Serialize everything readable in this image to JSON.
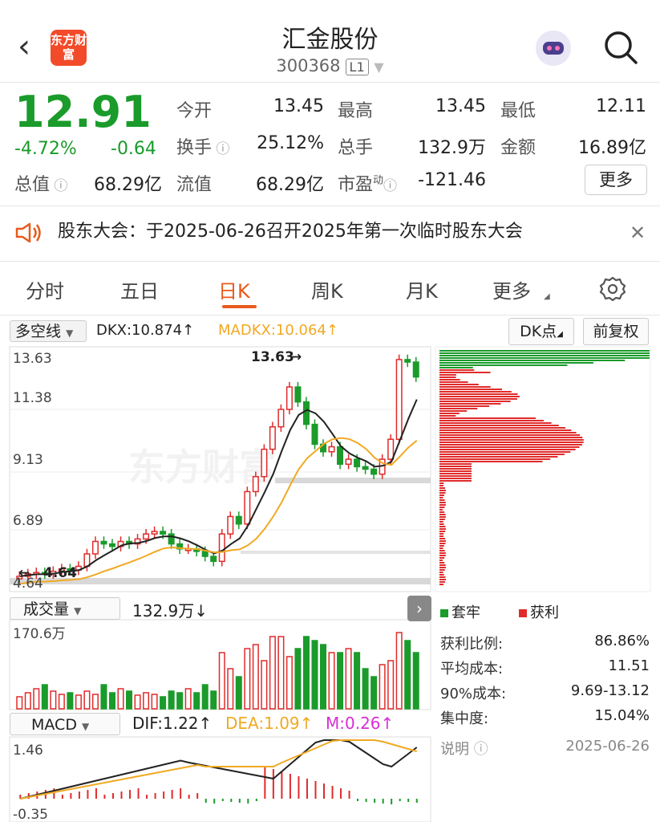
{
  "header": {
    "title": "汇金股份",
    "code": "300368",
    "market_tag": "L1",
    "logo_text": "东方财富"
  },
  "quote": {
    "price": "12.91",
    "change_pct": "-4.72%",
    "change": "-0.64",
    "open_label": "今开",
    "open": "13.45",
    "high_label": "最高",
    "high": "13.45",
    "low_label": "最低",
    "low": "12.11",
    "turnover_label": "换手",
    "turnover": "25.12%",
    "volume_label": "总手",
    "volume": "132.9万",
    "amount_label": "金额",
    "amount": "16.89亿",
    "mktcap_label": "总值",
    "mktcap": "68.29亿",
    "float_label": "流值",
    "float": "68.29亿",
    "pe_label": "市盈",
    "pe_sup": "动",
    "pe": "-121.46",
    "more": "更多"
  },
  "notice": {
    "text": "股东大会：于2025-06-26召开2025年第一次临时股东大会"
  },
  "tabs": [
    "分时",
    "五日",
    "日K",
    "周K",
    "月K",
    "更多"
  ],
  "indicator_bar": {
    "select": "多空线",
    "dkx": "DKX:10.874",
    "madkx": "MADKX:10.064",
    "dk_point": "DK点",
    "adjust": "前复权"
  },
  "kline": {
    "ticks": [
      "13.63",
      "11.38",
      "9.13",
      "6.89",
      "4.64"
    ],
    "max_label": "13.63",
    "min_label": "4.64",
    "watermark": "东方财富"
  },
  "volume_bar": {
    "select": "成交量",
    "value": "132.9万",
    "tick": "170.6万"
  },
  "macd_bar": {
    "select": "MACD",
    "dif": "DIF:1.22",
    "dea": "DEA:1.09",
    "m": "M:0.26",
    "ticks": [
      "1.46",
      "-0.35"
    ]
  },
  "chip": {
    "legend_trap": "套牢",
    "legend_profit": "获利",
    "rows": [
      {
        "k": "获利比例:",
        "v": "86.86%"
      },
      {
        "k": "平均成本:",
        "v": "11.51"
      },
      {
        "k": "90%成本:",
        "v": "9.69-13.12"
      },
      {
        "k": "集中度:",
        "v": "15.04%"
      }
    ],
    "note": "说明",
    "date": "2025-06-26"
  },
  "colors": {
    "up": "#e02b2b",
    "down": "#1a9b2b",
    "accent": "#e85a1c",
    "ma": "#f0a923"
  }
}
